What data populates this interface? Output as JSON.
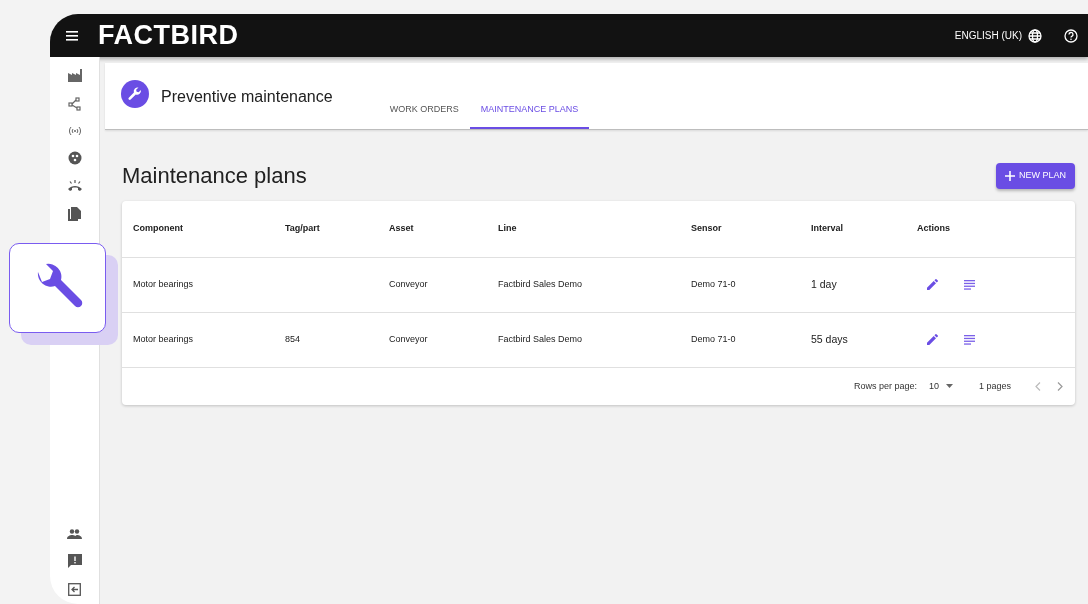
{
  "header": {
    "brand": "FACTBIRD",
    "language": "ENGLISH (UK)"
  },
  "page": {
    "title": "Preventive maintenance",
    "tabs": [
      {
        "label": "WORK ORDERS",
        "selected": false
      },
      {
        "label": "MAINTENANCE PLANS",
        "selected": true
      }
    ]
  },
  "section": {
    "heading": "Maintenance plans",
    "button": "NEW PLAN"
  },
  "table": {
    "columns": [
      "Component",
      "Tag/part",
      "Asset",
      "Line",
      "Sensor",
      "Interval",
      "Actions"
    ],
    "rows": [
      {
        "component": "Motor bearings",
        "tag_part": "",
        "asset": "Conveyor",
        "line": "Factbird Sales Demo",
        "sensor": "Demo 71-0",
        "interval": "1 day"
      },
      {
        "component": "Motor bearings",
        "tag_part": "854",
        "asset": "Conveyor",
        "line": "Factbird Sales Demo",
        "sensor": "Demo 71-0",
        "interval": "55 days"
      }
    ],
    "footer": {
      "rows_per_page_label": "Rows per page:",
      "rows_per_page": "10",
      "pages": "1 pages"
    }
  }
}
